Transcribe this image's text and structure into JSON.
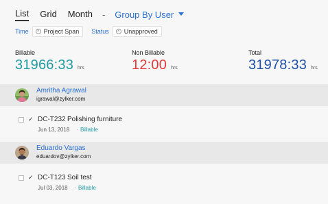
{
  "view_tabs": [
    "List",
    "Grid",
    "Month"
  ],
  "separator": "-",
  "group_by": {
    "label": "Group By User"
  },
  "filters": [
    {
      "label": "Time",
      "chip": "Project Span"
    },
    {
      "label": "Status",
      "chip": "Unapproved"
    }
  ],
  "stats": [
    {
      "label": "Billable",
      "value": "31966:33",
      "unit": "hrs",
      "color": "#1f9aa0"
    },
    {
      "label": "Non Billable",
      "value": "12:00",
      "unit": "hrs",
      "color": "#e23a3a"
    },
    {
      "label": "Total",
      "value": "31978:33",
      "unit": "hrs",
      "color": "#1f4fa8"
    }
  ],
  "groups": [
    {
      "name": "Amritha Agrawal",
      "email": "igrawal@zylker.com",
      "task": {
        "id": "DC-T232",
        "name": "Polishing furniture",
        "date": "Jun 13, 2018",
        "dot": "·",
        "billing": "Billable"
      }
    },
    {
      "name": "Eduardo Vargas",
      "email": "eduardov@zylker.com",
      "task": {
        "id": "DC-T123",
        "name": "Soil test",
        "date": "Jul 03, 2018",
        "dot": "·",
        "billing": "Billable"
      }
    }
  ],
  "colors": {
    "accent": "#2a6fd0",
    "billable": "#1f9aa0",
    "non_billable": "#e23a3a",
    "total": "#1f4fa8"
  }
}
